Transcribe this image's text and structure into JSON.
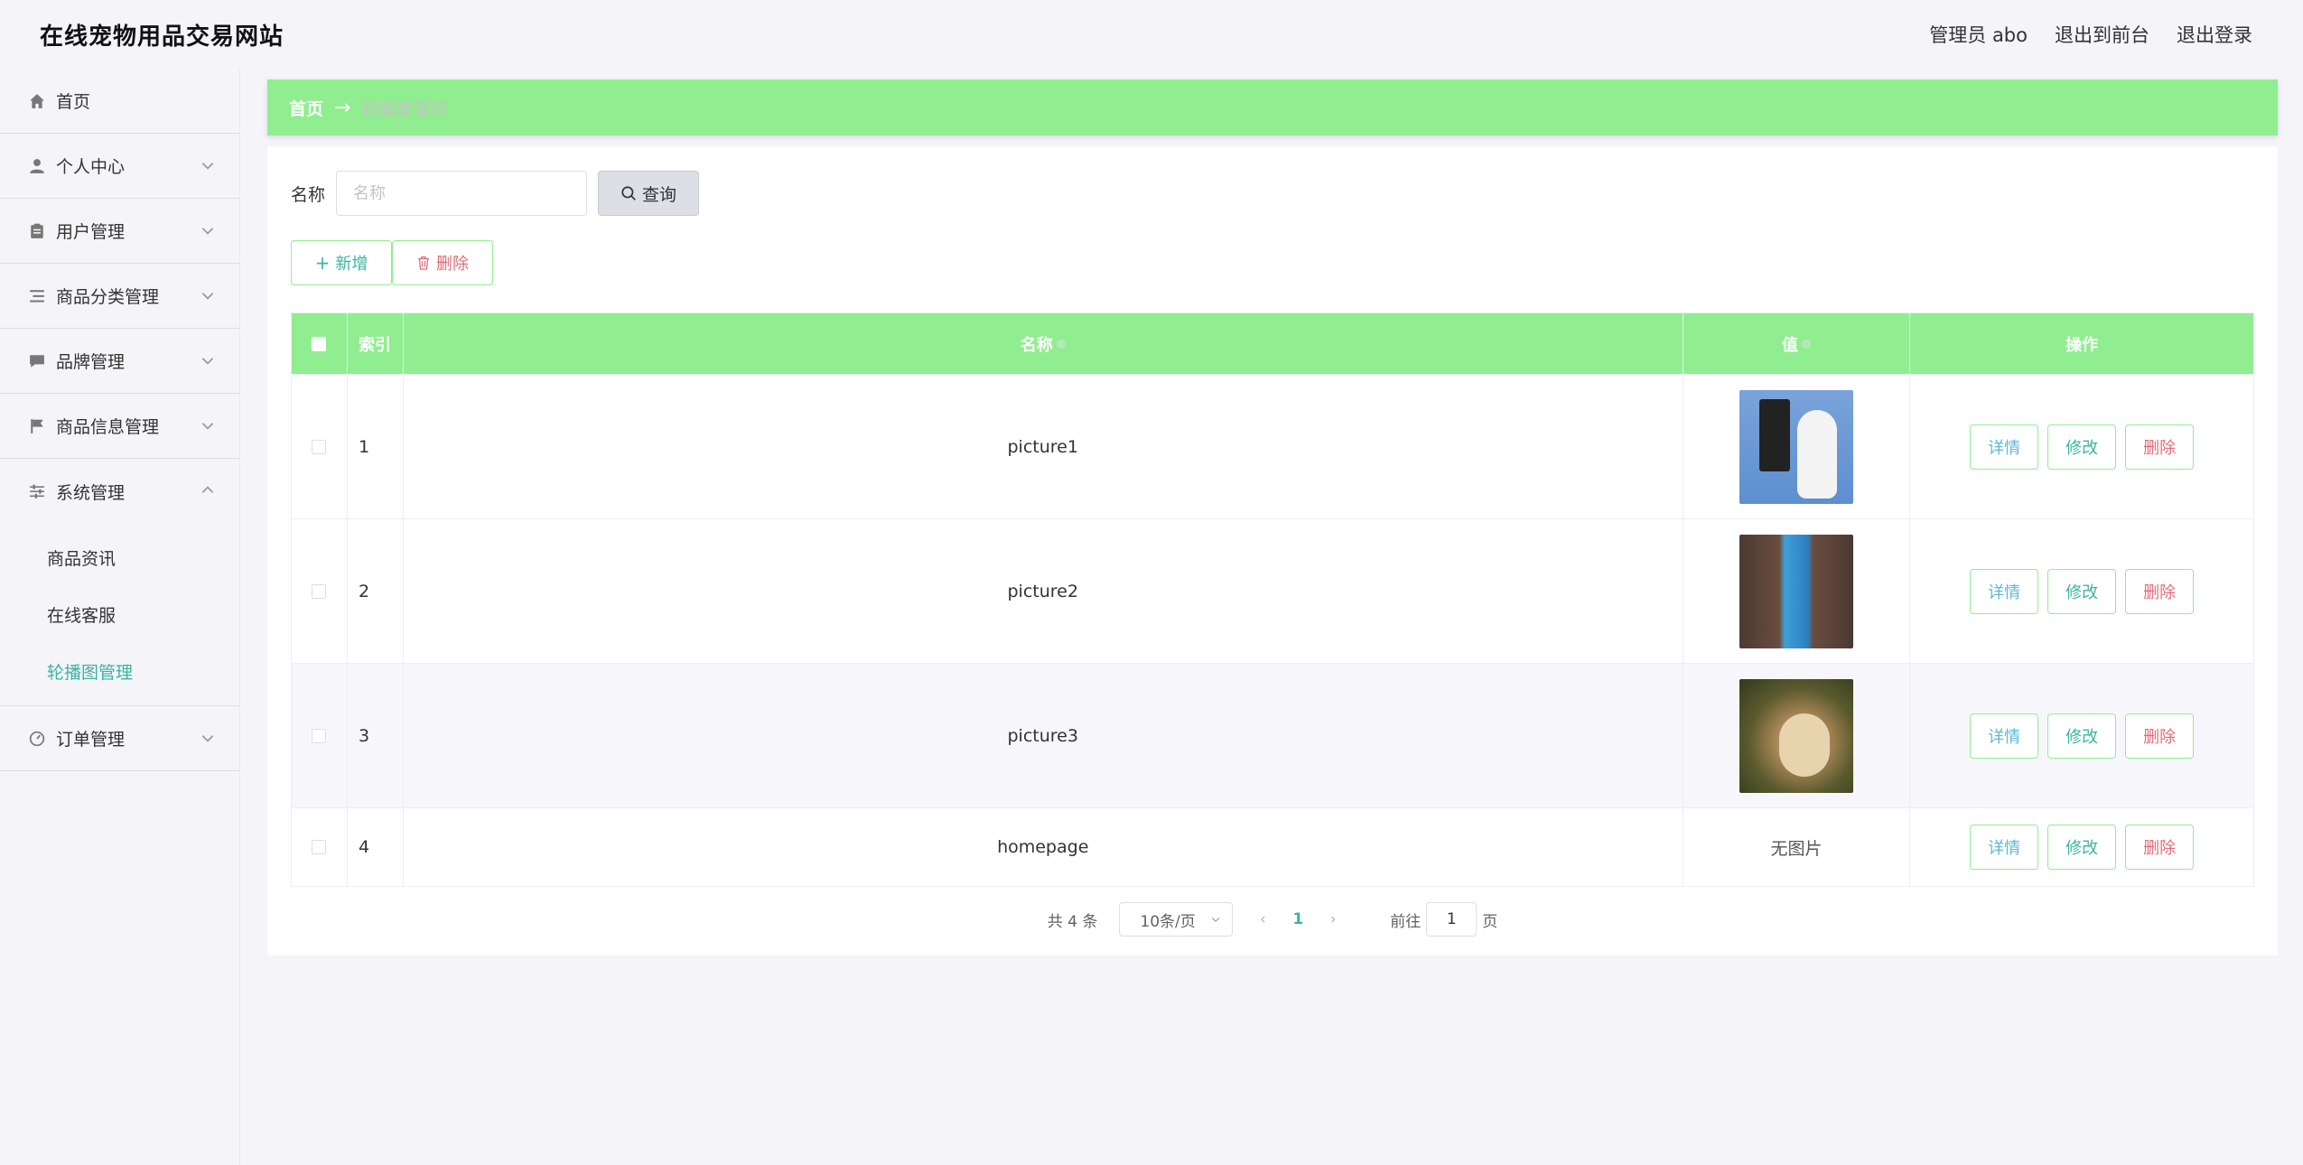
{
  "header": {
    "title": "在线宠物用品交易网站",
    "admin_label": "管理员 abo",
    "to_front": "退出到前台",
    "logout": "退出登录"
  },
  "sidebar": {
    "items": [
      {
        "label": "首页",
        "icon": "home-icon"
      },
      {
        "label": "个人中心",
        "icon": "user-icon"
      },
      {
        "label": "用户管理",
        "icon": "clipboard-icon"
      },
      {
        "label": "商品分类管理",
        "icon": "list-icon"
      },
      {
        "label": "品牌管理",
        "icon": "chat-icon"
      },
      {
        "label": "商品信息管理",
        "icon": "flag-icon"
      },
      {
        "label": "系统管理",
        "icon": "sliders-icon"
      },
      {
        "label": "订单管理",
        "icon": "gauge-icon"
      }
    ],
    "submenu": [
      "商品资讯",
      "在线客服",
      "轮播图管理"
    ]
  },
  "breadcrumb": {
    "home": "首页",
    "current": "轮播图管理"
  },
  "search": {
    "label": "名称",
    "placeholder": "名称",
    "button": "查询"
  },
  "actions": {
    "add": "新增",
    "delete": "删除"
  },
  "table": {
    "headers": {
      "index": "索引",
      "name": "名称",
      "value": "值",
      "ops": "操作"
    },
    "rows": [
      {
        "index": "1",
        "name": "picture1"
      },
      {
        "index": "2",
        "name": "picture2"
      },
      {
        "index": "3",
        "name": "picture3"
      },
      {
        "index": "4",
        "name": "homepage",
        "value_text": "无图片"
      }
    ],
    "ops": {
      "detail": "详情",
      "edit": "修改",
      "delete": "删除"
    }
  },
  "pager": {
    "total": "共 4 条",
    "page_size": "10条/页",
    "current_page": "1",
    "goto_prefix": "前往",
    "goto_value": "1",
    "goto_suffix": "页"
  },
  "colors": {
    "accent_green": "#90ee90",
    "active_teal": "#3bb4a0",
    "danger": "#e06c75"
  }
}
